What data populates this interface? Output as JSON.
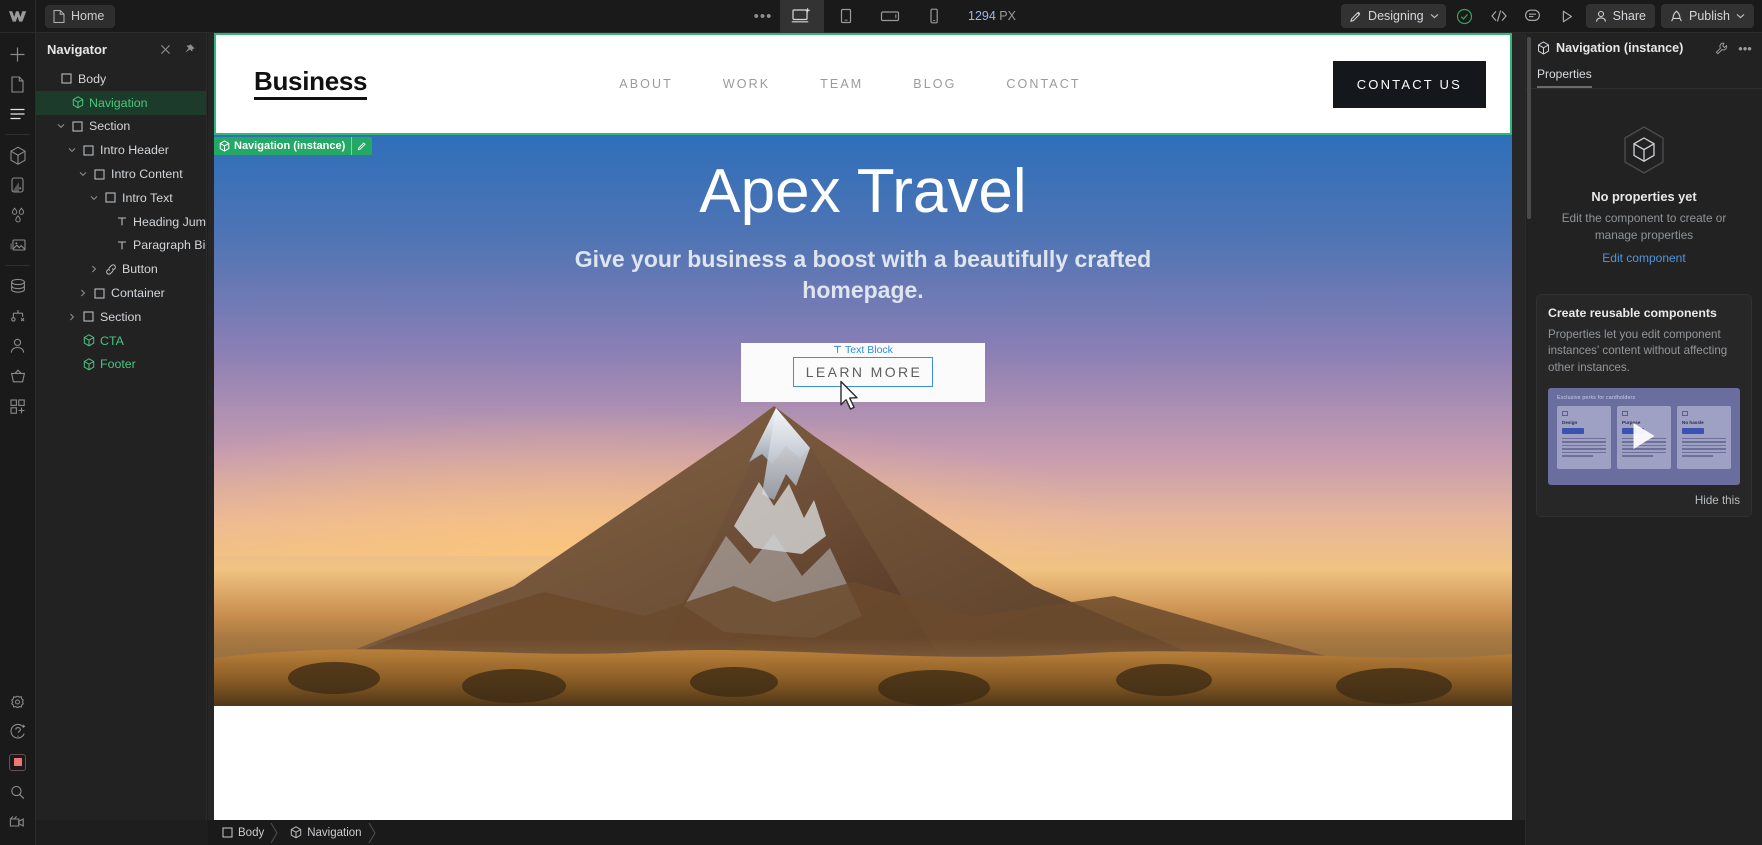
{
  "topbar": {
    "logo_icon": "webflow-logo",
    "page_chip": {
      "label": "Home",
      "icon": "page-icon"
    },
    "overflow_icon": "more-dots-icon",
    "breakpoints": [
      {
        "name": "desktop",
        "icon": "desktop-icon",
        "active": true
      },
      {
        "name": "tablet",
        "icon": "tablet-icon",
        "active": false
      },
      {
        "name": "mobile-landscape",
        "icon": "mobile-landscape-icon",
        "active": false
      },
      {
        "name": "mobile-portrait",
        "icon": "mobile-portrait-icon",
        "active": false
      }
    ],
    "viewport_width": "1294",
    "viewport_unit": "PX",
    "mode": {
      "label": "Designing",
      "icon": "brush-icon",
      "chevron": "chevron-down-icon"
    },
    "status_icon": "check-circle-icon",
    "code_icon": "code-brackets-icon",
    "comment_icon": "comment-icon",
    "preview_icon": "play-icon",
    "share": {
      "label": "Share",
      "icon": "person-icon"
    },
    "publish": {
      "label": "Publish",
      "icon": "rocket-icon",
      "chevron": "chevron-down-icon"
    }
  },
  "colors": {
    "accent_green": "#23a866",
    "selection_blue": "#3d8ee0",
    "link_blue": "#4f95e0",
    "panel_bg": "#222222",
    "canvas_bg": "#262626"
  },
  "rail": {
    "items": [
      {
        "name": "add-elements",
        "icon": "plus-icon"
      },
      {
        "name": "pages",
        "icon": "page-icon"
      },
      {
        "name": "navigator",
        "icon": "navigator-icon",
        "selected": true
      },
      {
        "name": "components",
        "icon": "cube-icon"
      },
      {
        "name": "style-selectors",
        "icon": "paint-swatch-icon"
      },
      {
        "name": "variables",
        "icon": "droplets-icon"
      },
      {
        "name": "assets",
        "icon": "image-icon"
      },
      {
        "name": "cms",
        "icon": "database-icon"
      },
      {
        "name": "logic",
        "icon": "logic-icon"
      },
      {
        "name": "users",
        "icon": "user-icon"
      },
      {
        "name": "ecommerce",
        "icon": "basket-icon"
      },
      {
        "name": "apps",
        "icon": "apps-grid-icon"
      }
    ],
    "bottom_items": [
      {
        "name": "settings",
        "icon": "gear-icon"
      },
      {
        "name": "help",
        "icon": "help-circle-icon"
      },
      {
        "name": "record",
        "icon": "record-square-icon"
      },
      {
        "name": "search",
        "icon": "search-icon"
      },
      {
        "name": "video",
        "icon": "video-camera-icon"
      }
    ]
  },
  "navigator": {
    "title": "Navigator",
    "close_icon": "close-icon",
    "pin_icon": "pin-icon",
    "tree": [
      {
        "label": "Body",
        "depth": 0,
        "icon": "box-icon",
        "caret": "",
        "kind": "element"
      },
      {
        "label": "Navigation",
        "depth": 1,
        "icon": "component-icon",
        "caret": "",
        "kind": "component",
        "selected": true
      },
      {
        "label": "Section",
        "depth": 1,
        "icon": "box-icon",
        "caret": "v",
        "kind": "element"
      },
      {
        "label": "Intro Header",
        "depth": 2,
        "icon": "box-icon",
        "caret": "v",
        "kind": "element"
      },
      {
        "label": "Intro Content",
        "depth": 3,
        "icon": "box-icon",
        "caret": "v",
        "kind": "element"
      },
      {
        "label": "Intro Text",
        "depth": 4,
        "icon": "box-icon",
        "caret": "v",
        "kind": "element"
      },
      {
        "label": "Heading Jumbo",
        "depth": 5,
        "icon": "text-icon",
        "caret": "",
        "kind": "text"
      },
      {
        "label": "Paragraph Big...",
        "depth": 5,
        "icon": "text-icon",
        "caret": "",
        "kind": "text"
      },
      {
        "label": "Button",
        "depth": 4,
        "icon": "link-icon",
        "caret": ">",
        "kind": "link"
      },
      {
        "label": "Container",
        "depth": 3,
        "icon": "box-icon",
        "caret": ">",
        "kind": "element"
      },
      {
        "label": "Section",
        "depth": 2,
        "icon": "box-icon",
        "caret": ">",
        "kind": "element"
      },
      {
        "label": "CTA",
        "depth": 2,
        "icon": "component-icon",
        "caret": "",
        "kind": "component"
      },
      {
        "label": "Footer",
        "depth": 2,
        "icon": "component-icon",
        "caret": "",
        "kind": "component"
      }
    ]
  },
  "canvas": {
    "instance_badge": {
      "label": "Navigation (instance)",
      "icon": "component-icon",
      "edit_icon": "pencil-icon"
    },
    "site": {
      "brand": "Business",
      "nav_links": [
        "ABOUT",
        "WORK",
        "TEAM",
        "BLOG",
        "CONTACT"
      ],
      "cta_label": "CONTACT US",
      "hero_heading": "Apex Travel",
      "hero_sub": "Give your business a boost with a beautifully crafted homepage.",
      "learn_more_label": "LEARN MORE",
      "selected_tag": "Text Block",
      "selected_tag_icon": "text-icon"
    }
  },
  "breadcrumb": {
    "items": [
      {
        "label": "Body",
        "icon": "box-icon"
      },
      {
        "label": "Navigation",
        "icon": "component-icon"
      }
    ]
  },
  "right_panel": {
    "title": "Navigation (instance)",
    "title_icon": "component-icon",
    "wrench_icon": "wrench-icon",
    "more_icon": "more-dots-icon",
    "tab": "Properties",
    "empty": {
      "icon": "cube-outline-icon",
      "title": "No properties yet",
      "subtitle": "Edit the component to create or manage properties",
      "link": "Edit component"
    },
    "promo": {
      "title": "Create reusable components",
      "body": "Properties let you edit component instances' content without affecting other instances.",
      "video_caption": "Exclusive perks for cardholders",
      "video_cards": [
        {
          "title": "Design",
          "button": "See designs"
        },
        {
          "title": "Purpose",
          "button": "Learn more"
        },
        {
          "title": "No hassle",
          "button": "Get started"
        }
      ],
      "play_icon": "play-icon",
      "hide_label": "Hide this"
    }
  }
}
